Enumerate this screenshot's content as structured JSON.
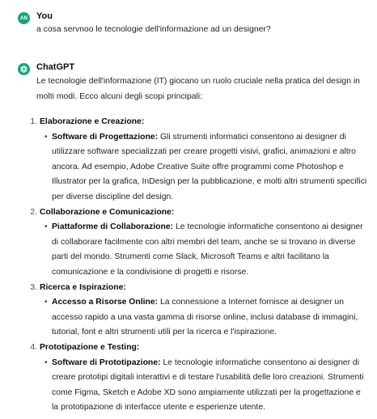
{
  "conversation": {
    "user": {
      "avatar_initials": "AN",
      "author": "You",
      "text": "a cosa servnoo le tecnologie dell'informazione ad un designer?"
    },
    "assistant": {
      "author": "ChatGPT",
      "avatar_icon": "openai-logo-icon",
      "intro": "Le tecnologie dell'informazione (IT) giocano un ruolo cruciale nella pratica del design in molti modi. Ecco alcuni degli scopi principali:",
      "items": [
        {
          "number": "1.",
          "title": "Elaborazione e Creazione:",
          "sub_title": "Software di Progettazione:",
          "sub_text": " Gli strumenti informatici consentono ai designer di utilizzare software specializzati per creare progetti visivi, grafici, animazioni e altro ancora. Ad esempio, Adobe Creative Suite offre programmi come Photoshop e Illustrator per la grafica, InDesign per la pubblicazione, e molti altri strumenti specifici per diverse discipline del design."
        },
        {
          "number": "2.",
          "title": "Collaborazione e Comunicazione:",
          "sub_title": "Piattaforme di Collaborazione:",
          "sub_text": " Le tecnologie informatiche consentono ai designer di collaborare facilmente con altri membri del team, anche se si trovano in diverse parti del mondo. Strumenti come Slack, Microsoft Teams e altri facilitano la comunicazione e la condivisione di progetti e risorse."
        },
        {
          "number": "3.",
          "title": "Ricerca e Ispirazione:",
          "sub_title": "Accesso a Risorse Online:",
          "sub_text": " La connessione a Internet fornisce ai designer un accesso rapido a una vasta gamma di risorse online, inclusi database di immagini, tutorial, font e altri strumenti utili per la ricerca e l'ispirazione."
        },
        {
          "number": "4.",
          "title": "Prototipazione e Testing:",
          "sub_title": "Software di Prototipazione:",
          "sub_text": " Le tecnologie informatiche consentono ai designer di creare prototipi digitali interattivi e di testare l'usabilità delle loro creazioni. Strumenti come Figma, Sketch e Adobe XD sono ampiamente utilizzati per la progettazione e la prototipazione di interfacce utente e esperienze utente."
        }
      ]
    },
    "colors": {
      "accent": "#10a37f",
      "text": "#0d0d0d"
    }
  }
}
